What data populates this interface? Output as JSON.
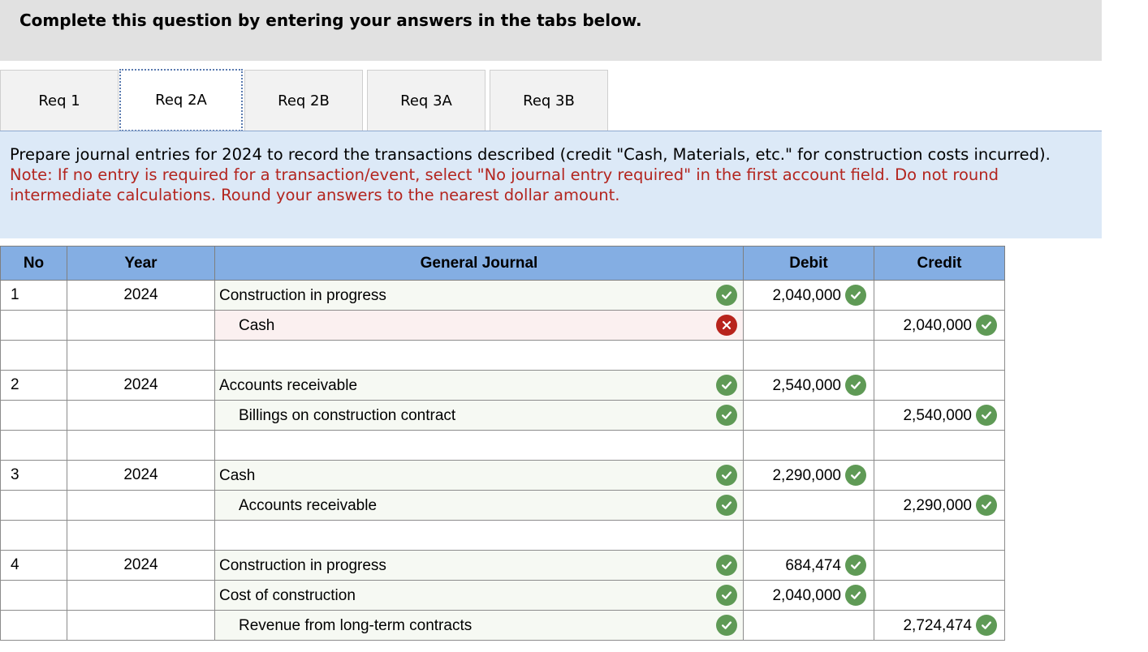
{
  "banner": {
    "title": "Complete this question by entering your answers in the tabs below."
  },
  "tabs": [
    {
      "label": "Req 1"
    },
    {
      "label": "Req 2A"
    },
    {
      "label": "Req 2B"
    },
    {
      "label": "Req 3A"
    },
    {
      "label": "Req 3B"
    }
  ],
  "active_tab": "Req 2A",
  "instructions": {
    "text": "Prepare journal entries for 2024 to record the transactions described (credit \"Cash, Materials, etc.\" for construction costs incurred).",
    "note": "Note: If no entry is required for a transaction/event, select \"No journal entry required\" in the first account field. Do not round intermediate calculations. Round your answers to the nearest dollar amount."
  },
  "table": {
    "headers": {
      "no": "No",
      "year": "Year",
      "journal": "General Journal",
      "debit": "Debit",
      "credit": "Credit"
    },
    "rows": [
      {
        "no": "1",
        "year": "2024",
        "account": "Construction in progress",
        "indent": false,
        "account_status": "correct",
        "debit": "2,040,000",
        "credit": ""
      },
      {
        "no": "",
        "year": "",
        "account": "Cash",
        "indent": true,
        "account_status": "incorrect",
        "debit": "",
        "credit": "2,040,000"
      },
      {
        "no": "",
        "year": "",
        "account": "",
        "indent": false,
        "account_status": "",
        "debit": "",
        "credit": ""
      },
      {
        "no": "2",
        "year": "2024",
        "account": "Accounts receivable",
        "indent": false,
        "account_status": "correct",
        "debit": "2,540,000",
        "credit": ""
      },
      {
        "no": "",
        "year": "",
        "account": "Billings on construction contract",
        "indent": true,
        "account_status": "correct",
        "debit": "",
        "credit": "2,540,000"
      },
      {
        "no": "",
        "year": "",
        "account": "",
        "indent": false,
        "account_status": "",
        "debit": "",
        "credit": ""
      },
      {
        "no": "3",
        "year": "2024",
        "account": "Cash",
        "indent": false,
        "account_status": "correct",
        "debit": "2,290,000",
        "credit": ""
      },
      {
        "no": "",
        "year": "",
        "account": "Accounts receivable",
        "indent": true,
        "account_status": "correct",
        "debit": "",
        "credit": "2,290,000"
      },
      {
        "no": "",
        "year": "",
        "account": "",
        "indent": false,
        "account_status": "",
        "debit": "",
        "credit": ""
      },
      {
        "no": "4",
        "year": "2024",
        "account": "Construction in progress",
        "indent": false,
        "account_status": "correct",
        "debit": "684,474",
        "credit": ""
      },
      {
        "no": "",
        "year": "",
        "account": "Cost of construction",
        "indent": false,
        "account_status": "correct",
        "debit": "2,040,000",
        "credit": ""
      },
      {
        "no": "",
        "year": "",
        "account": "Revenue from long-term contracts",
        "indent": true,
        "account_status": "correct",
        "debit": "",
        "credit": "2,724,474"
      }
    ]
  },
  "colors": {
    "header_bg": "#84aee3",
    "correct": "#5f9a56",
    "incorrect": "#b8231c",
    "note": "#b3251f",
    "instructions_bg": "#dce9f7"
  }
}
